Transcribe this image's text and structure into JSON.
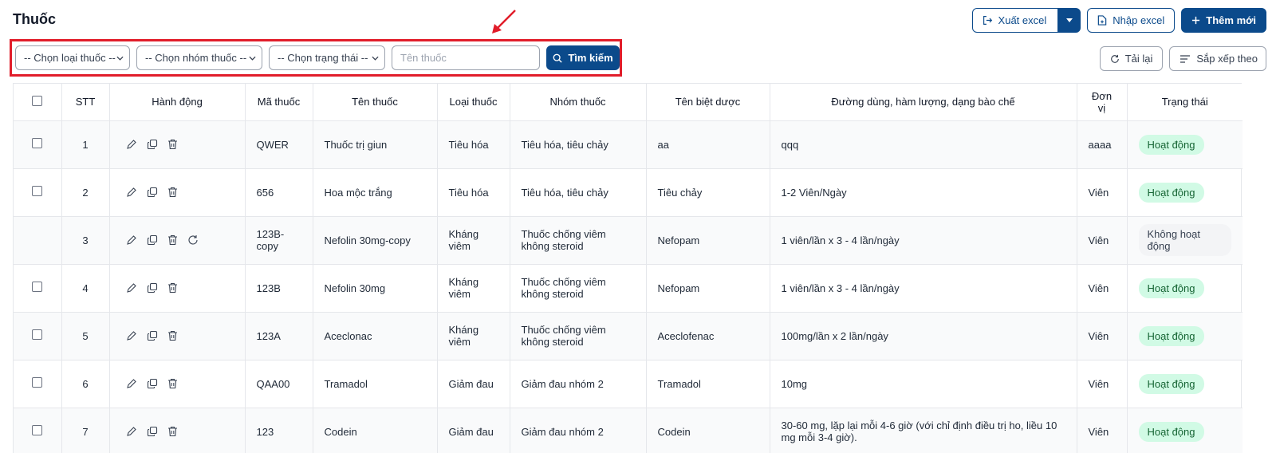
{
  "title": "Thuốc",
  "toolbar": {
    "export_label": "Xuất excel",
    "import_label": "Nhập excel",
    "add_label": "Thêm mới",
    "reload_label": "Tải lại",
    "sort_label": "Sắp xếp theo"
  },
  "filters": {
    "type_select": "-- Chọn loại thuốc --",
    "group_select": "-- Chọn nhóm thuốc --",
    "status_select": "-- Chọn trạng thái --",
    "name_placeholder": "Tên thuốc",
    "search_label": "Tìm kiếm"
  },
  "table": {
    "columns": [
      "STT",
      "Hành động",
      "Mã thuốc",
      "Tên thuốc",
      "Loại thuốc",
      "Nhóm thuốc",
      "Tên biệt dược",
      "Đường dùng, hàm lượng, dạng bào chế",
      "Đơn vị",
      "Trạng thái"
    ],
    "rows": [
      {
        "stt": "1",
        "code": "QWER",
        "name": "Thuốc trị giun",
        "type": "Tiêu hóa",
        "group": "Tiêu hóa, tiêu chảy",
        "brand": "aa",
        "usage": "qqq",
        "unit": "aaaa",
        "status": "Hoạt động",
        "active": true,
        "checkbox": true,
        "restore": false
      },
      {
        "stt": "2",
        "code": "656",
        "name": "Hoa mộc trắng",
        "type": "Tiêu hóa",
        "group": "Tiêu hóa, tiêu chảy",
        "brand": "Tiêu chảy",
        "usage": "1-2 Viên/Ngày",
        "unit": "Viên",
        "status": "Hoạt động",
        "active": true,
        "checkbox": true,
        "restore": false
      },
      {
        "stt": "3",
        "code": "123B-copy",
        "name": "Nefolin 30mg-copy",
        "type": "Kháng viêm",
        "group": "Thuốc chống viêm không steroid",
        "brand": "Nefopam",
        "usage": "1 viên/lần x 3 - 4 lần/ngày",
        "unit": "Viên",
        "status": "Không hoạt động",
        "active": false,
        "checkbox": false,
        "restore": true
      },
      {
        "stt": "4",
        "code": "123B",
        "name": "Nefolin 30mg",
        "type": "Kháng viêm",
        "group": "Thuốc chống viêm không steroid",
        "brand": "Nefopam",
        "usage": "1 viên/lần x 3 - 4 lần/ngày",
        "unit": "Viên",
        "status": "Hoạt động",
        "active": true,
        "checkbox": true,
        "restore": false
      },
      {
        "stt": "5",
        "code": "123A",
        "name": "Aceclonac",
        "type": "Kháng viêm",
        "group": "Thuốc chống viêm không steroid",
        "brand": "Aceclofenac",
        "usage": "100mg/lần x 2 lần/ngày",
        "unit": "Viên",
        "status": "Hoạt động",
        "active": true,
        "checkbox": true,
        "restore": false
      },
      {
        "stt": "6",
        "code": "QAA00",
        "name": "Tramadol",
        "type": "Giảm đau",
        "group": "Giảm đau nhóm 2",
        "brand": "Tramadol",
        "usage": "10mg",
        "unit": "Viên",
        "status": "Hoạt động",
        "active": true,
        "checkbox": true,
        "restore": false
      },
      {
        "stt": "7",
        "code": "123",
        "name": "Codein",
        "type": "Giảm đau",
        "group": "Giảm đau nhóm 2",
        "brand": "Codein",
        "usage": "30-60 mg, lặp lại mỗi 4-6 giờ (với chỉ định điều trị ho, liều 10 mg mỗi 3-4 giờ).",
        "unit": "Viên",
        "status": "Hoạt động",
        "active": true,
        "checkbox": true,
        "restore": false
      }
    ]
  },
  "colors": {
    "primary": "#0b4a8b",
    "highlight": "#e11d2a",
    "active_badge_bg": "#d1fae5",
    "active_badge_text": "#166534"
  }
}
